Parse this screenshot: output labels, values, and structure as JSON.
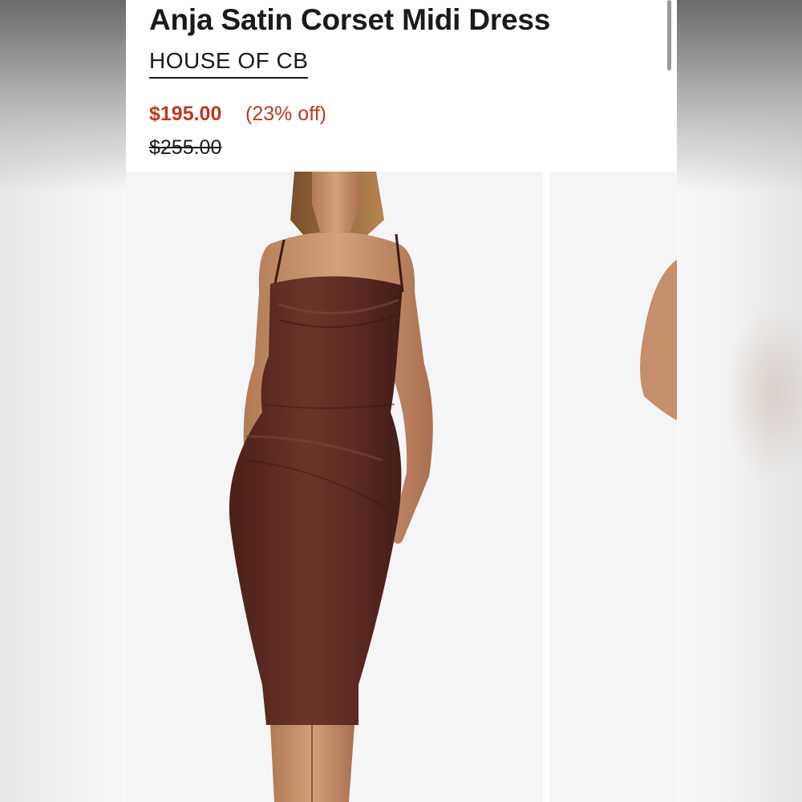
{
  "product": {
    "title": "Anja Satin Corset Midi Dress",
    "brand": "HOUSE OF CB",
    "sale_price": "$195.00",
    "discount": "(23% off)",
    "original_price": "$255.00"
  },
  "gallery": {
    "images": [
      {
        "alt": "model wearing brown satin corset midi dress",
        "dress_color": "#5a2a22"
      },
      {
        "alt": "partial next gallery image"
      }
    ]
  },
  "colors": {
    "price": "#c0391f",
    "text": "#1a1a1a",
    "photo_bg": "#f5f5f5"
  }
}
